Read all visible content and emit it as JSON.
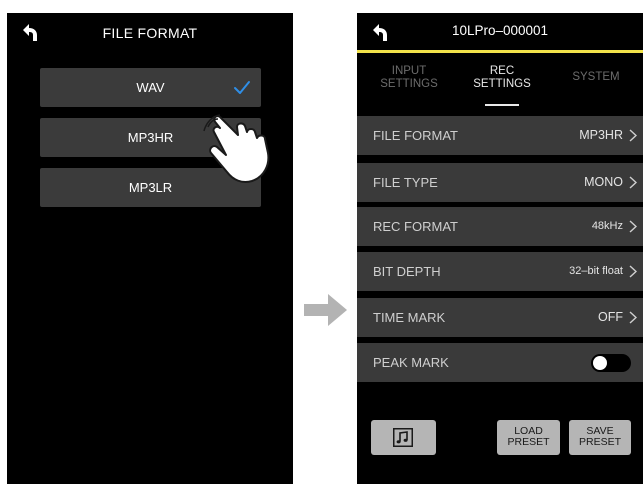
{
  "left_screen": {
    "title": "FILE FORMAT",
    "options": [
      {
        "label": "WAV",
        "selected": true
      },
      {
        "label": "MP3HR",
        "selected": false
      },
      {
        "label": "MP3LR",
        "selected": false
      }
    ]
  },
  "right_screen": {
    "device_name": "10LPro–000001",
    "tabs": [
      {
        "line1": "INPUT",
        "line2": "SETTINGS",
        "active": false
      },
      {
        "line1": "REC",
        "line2": "SETTINGS",
        "active": true
      },
      {
        "line1": "SYSTEM",
        "line2": "",
        "active": false
      }
    ],
    "rows": [
      {
        "label": "FILE FORMAT",
        "value": "MP3HR"
      },
      {
        "label": "FILE TYPE",
        "value": "MONO"
      },
      {
        "label": "REC FORMAT",
        "value": "48kHz"
      },
      {
        "label": "BIT DEPTH",
        "value": "32–bit float"
      },
      {
        "label": "TIME MARK",
        "value": "OFF"
      },
      {
        "label": "PEAK MARK",
        "toggle_on": false
      }
    ],
    "buttons": {
      "load_preset": {
        "line1": "LOAD",
        "line2": "PRESET"
      },
      "save_preset": {
        "line1": "SAVE",
        "line2": "PRESET"
      }
    }
  },
  "colors": {
    "screen_bg": "#000000",
    "row_bg": "#3a3a3a",
    "accent_line": "#f2e34a",
    "checkmark": "#2f8ee6",
    "button_bg": "#b5b5b5",
    "arrow": "#b3b3b3"
  },
  "icons": [
    "back-arrow-icon",
    "checkmark-icon",
    "pointing-hand-icon",
    "right-arrow-icon",
    "chevron-right-icon",
    "music-note-icon"
  ]
}
